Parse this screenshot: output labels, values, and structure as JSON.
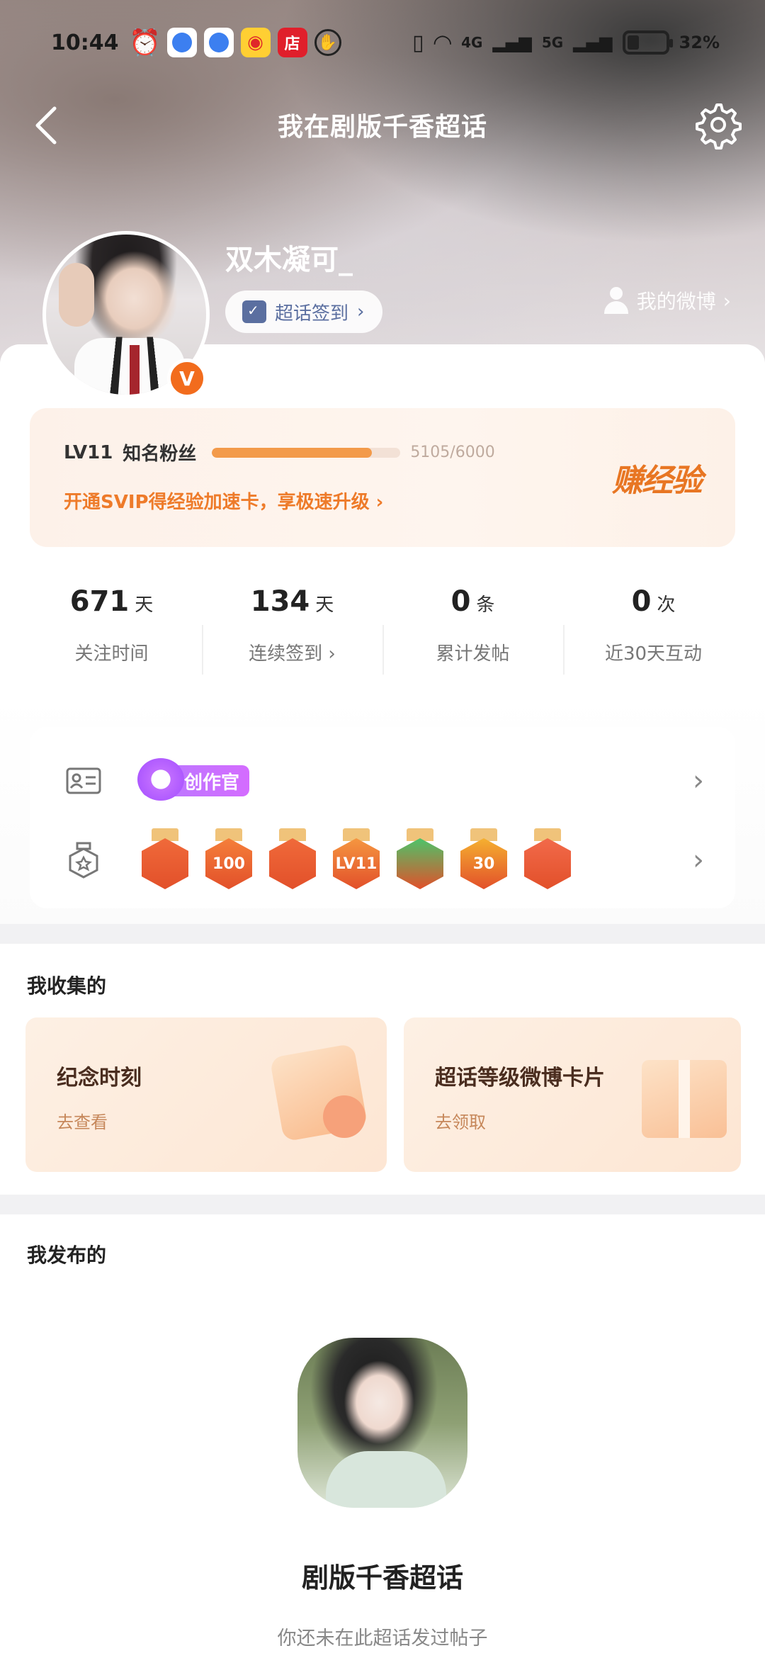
{
  "status_bar": {
    "time": "10:44",
    "network_4g": "4G",
    "network_5g": "5G",
    "battery_percent": "32%",
    "battery_level": 0.32,
    "app_icons": [
      "alarm-icon",
      "browser-icon",
      "browser-icon",
      "weibo-icon",
      "store-icon",
      "hand-icon"
    ]
  },
  "header": {
    "title": "我在剧版千香超话",
    "back_icon": "chevron-left-icon",
    "settings_icon": "gear-icon"
  },
  "profile": {
    "username": "双木凝可_",
    "verified_badge": "V",
    "checkin_label": "超话签到",
    "my_weibo_label": "我的微博"
  },
  "level": {
    "lv": "LV11",
    "name": "知名粉丝",
    "progress_text": "5105/6000",
    "progress_fraction": 0.85,
    "svip_text": "开通SVIP得经验加速卡，享极速升级",
    "earn_label": "赚经验"
  },
  "stats": [
    {
      "value": "671",
      "unit": "天",
      "label": "关注时间"
    },
    {
      "value": "134",
      "unit": "天",
      "label": "连续签到"
    },
    {
      "value": "0",
      "unit": "条",
      "label": "累计发帖"
    },
    {
      "value": "0",
      "unit": "次",
      "label": "近30天互动"
    }
  ],
  "badges": {
    "creator_label": "创作官",
    "medal_labels": [
      "",
      "100",
      "",
      "LV11",
      "",
      "30",
      ""
    ],
    "medal_colors": [
      "#f06a3a",
      "#f57f3a",
      "#f06a3a",
      "#f59640",
      "#4cc46a",
      "#f5b030",
      "#f26a4a"
    ]
  },
  "collections": {
    "title": "我收集的",
    "cards": [
      {
        "title": "纪念时刻",
        "subtitle": "去查看"
      },
      {
        "title": "超话等级微博卡片",
        "subtitle": "去领取"
      }
    ]
  },
  "posts": {
    "title": "我发布的",
    "topic_name": "剧版千香超话",
    "empty_text": "你还未在此超话发过帖子"
  }
}
